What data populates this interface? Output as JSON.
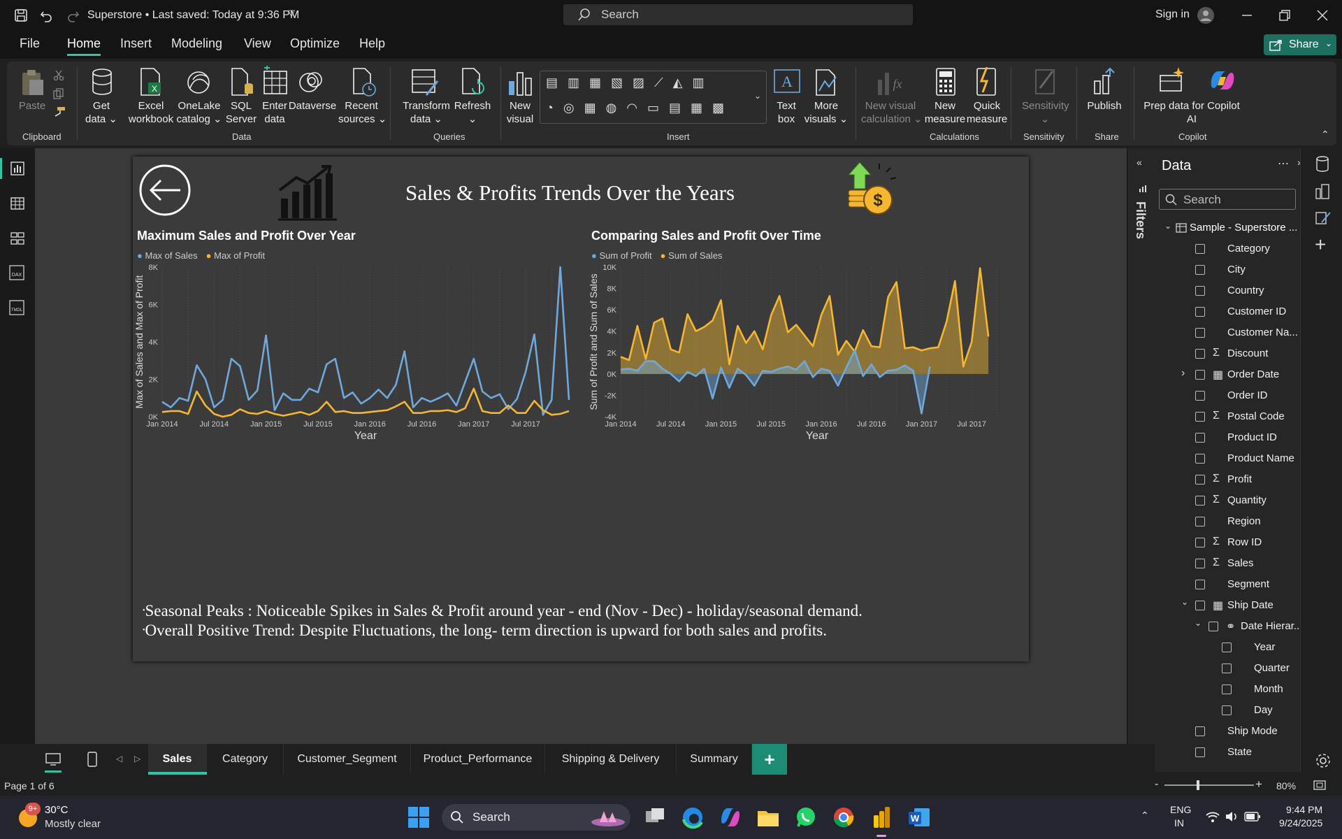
{
  "window": {
    "title": "Superstore • Last saved: Today at 9:36 PM",
    "search_placeholder": "Search",
    "sign_in": "Sign in"
  },
  "menu": {
    "items": [
      "File",
      "Home",
      "Insert",
      "Modeling",
      "View",
      "Optimize",
      "Help"
    ],
    "active": "Home",
    "share": "Share"
  },
  "ribbon": {
    "clipboard": {
      "paste": "Paste",
      "group": "Clipboard"
    },
    "data": {
      "get_data": [
        "Get",
        "data ⌄"
      ],
      "excel": [
        "Excel",
        "workbook"
      ],
      "onelake": [
        "OneLake",
        "catalog ⌄"
      ],
      "sql": [
        "SQL",
        "Server"
      ],
      "enter": [
        "Enter",
        "data"
      ],
      "dataverse": "Dataverse",
      "recent": [
        "Recent",
        "sources ⌄"
      ],
      "group": "Data"
    },
    "queries": {
      "transform": [
        "Transform",
        "data ⌄"
      ],
      "refresh": [
        "Refresh",
        "⌄"
      ],
      "group": "Queries"
    },
    "insert": {
      "new_visual": [
        "New",
        "visual"
      ],
      "text_box": [
        "Text",
        "box"
      ],
      "more_visuals": [
        "More",
        "visuals ⌄"
      ],
      "group": "Insert"
    },
    "calculations": {
      "new_visual_calc": [
        "New visual",
        "calculation ⌄"
      ],
      "new_measure": [
        "New",
        "measure"
      ],
      "quick_measure": [
        "Quick",
        "measure"
      ],
      "group": "Calculations"
    },
    "sensitivity": {
      "label": [
        "Sensitivity",
        "⌄"
      ],
      "group": "Sensitivity"
    },
    "share": {
      "publish": "Publish",
      "group": "Share"
    },
    "copilot": {
      "prep": [
        "Prep data for Copilot",
        "AI"
      ],
      "group": "Copilot"
    }
  },
  "report": {
    "title": "Sales & Profits Trends Over the Years",
    "bullets": [
      "Seasonal Peaks : Noticeable Spikes in Sales & Profit around year - end (Nov - Dec) - holiday/seasonal demand.",
      "Overall Positive Trend: Despite Fluctuations, the long- term direction is upward for both sales and profits."
    ]
  },
  "chart_data": [
    {
      "type": "line",
      "title": "Maximum Sales and Profit Over Year",
      "xlabel": "Year",
      "ylabel": "Max of Sales and Max of Profit",
      "ylim": [
        0,
        8000
      ],
      "yticks": [
        "0K",
        "2K",
        "4K",
        "6K",
        "8K"
      ],
      "xticks": [
        "Jan 2014",
        "Jul 2014",
        "Jan 2015",
        "Jul 2015",
        "Jan 2016",
        "Jul 2016",
        "Jan 2017",
        "Jul 2017"
      ],
      "x_start": "2014-01",
      "legend": "top-left",
      "series": [
        {
          "name": "Max of Sales",
          "color": "#6fa8dc",
          "values": [
            800,
            500,
            1000,
            850,
            2750,
            2000,
            500,
            900,
            3100,
            2700,
            900,
            1400,
            4350,
            350,
            1250,
            900,
            900,
            1500,
            1300,
            2800,
            3100,
            1000,
            1300,
            700,
            1000,
            1450,
            1000,
            1700,
            3500,
            500,
            1000,
            800,
            1000,
            1250,
            600,
            1850,
            3100,
            1350,
            1000,
            1200,
            400,
            950,
            2400,
            4400,
            100,
            900,
            8000,
            900
          ]
        },
        {
          "name": "Max of Profit",
          "color": "#f5b731",
          "values": [
            250,
            300,
            300,
            150,
            1350,
            600,
            150,
            0,
            100,
            400,
            200,
            150,
            300,
            150,
            50,
            150,
            250,
            100,
            300,
            800,
            250,
            300,
            200,
            200,
            250,
            300,
            350,
            550,
            800,
            200,
            200,
            300,
            300,
            350,
            250,
            450,
            1500,
            300,
            200,
            200,
            600,
            200,
            200,
            850,
            350,
            100,
            150,
            300
          ]
        }
      ]
    },
    {
      "type": "area",
      "title": "Comparing Sales and Profit Over Time",
      "xlabel": "Year",
      "ylabel": "Sum of Profit and Sum of Sales",
      "ylim": [
        -4000,
        10000
      ],
      "yticks": [
        "-4K",
        "-2K",
        "0K",
        "2K",
        "4K",
        "6K",
        "8K",
        "10K"
      ],
      "xticks": [
        "Jan 2014",
        "Jul 2014",
        "Jan 2015",
        "Jul 2015",
        "Jan 2016",
        "Jul 2016",
        "Jan 2017",
        "Jul 2017"
      ],
      "x_start": "2014-01",
      "legend": "top-left",
      "series": [
        {
          "name": "Sum of Profit",
          "color": "#6fa8dc",
          "values": [
            400,
            500,
            300,
            1200,
            1200,
            500,
            0,
            -700,
            200,
            -200,
            500,
            -2300,
            600,
            -1300,
            500,
            -100,
            -1100,
            300,
            200,
            500,
            700,
            400,
            1200,
            -300,
            500,
            300,
            -1100,
            600,
            2200,
            -200,
            900,
            -300,
            300,
            400,
            800,
            300,
            -3700,
            700
          ]
        },
        {
          "name": "Sum of Sales",
          "color": "#f5b731",
          "values": [
            1600,
            1300,
            4500,
            1400,
            4800,
            5200,
            2300,
            2000,
            5600,
            4000,
            4400,
            5000,
            6900,
            900,
            4500,
            2900,
            4000,
            2300,
            5500,
            7300,
            3900,
            4600,
            3600,
            2600,
            5500,
            7300,
            1800,
            3100,
            2100,
            4100,
            2600,
            2500,
            7200,
            8600,
            2400,
            2500,
            2200,
            2400,
            2500,
            4900,
            8700,
            700,
            3000,
            9900,
            3500
          ]
        }
      ]
    }
  ],
  "filters": {
    "label": "Filters"
  },
  "datapane": {
    "title": "Data",
    "search_placeholder": "Search",
    "table": "Sample - Superstore ...",
    "fields": [
      {
        "name": "Category",
        "sigma": false
      },
      {
        "name": "City",
        "sigma": false
      },
      {
        "name": "Country",
        "sigma": false
      },
      {
        "name": "Customer ID",
        "sigma": false
      },
      {
        "name": "Customer Na...",
        "sigma": false
      },
      {
        "name": "Discount",
        "sigma": true
      },
      {
        "name": "Order Date",
        "sigma": false,
        "date": true,
        "expand": "›"
      },
      {
        "name": "Order ID",
        "sigma": false
      },
      {
        "name": "Postal Code",
        "sigma": true
      },
      {
        "name": "Product ID",
        "sigma": false
      },
      {
        "name": "Product Name",
        "sigma": false
      },
      {
        "name": "Profit",
        "sigma": true
      },
      {
        "name": "Quantity",
        "sigma": true
      },
      {
        "name": "Region",
        "sigma": false
      },
      {
        "name": "Row ID",
        "sigma": true
      },
      {
        "name": "Sales",
        "sigma": true
      },
      {
        "name": "Segment",
        "sigma": false
      },
      {
        "name": "Ship Date",
        "sigma": false,
        "date": true,
        "expand": "⌄"
      }
    ],
    "hierarchy": {
      "name": "Date Hierar...",
      "levels": [
        "Year",
        "Quarter",
        "Month",
        "Day"
      ]
    },
    "after": [
      {
        "name": "Ship Mode"
      },
      {
        "name": "State"
      }
    ]
  },
  "pages": {
    "tabs": [
      "Sales",
      "Category",
      "Customer_Segment",
      "Product_Performance",
      "Shipping & Delivery",
      "Summary"
    ],
    "active": "Sales",
    "add": "+"
  },
  "status": {
    "page": "Page 1 of 6",
    "zoom": "80%"
  },
  "taskbar": {
    "weather_temp": "30°C",
    "weather_desc": "Mostly clear",
    "badge": "9+",
    "search": "Search",
    "lang": [
      "ENG",
      "IN"
    ],
    "time": "9:44 PM",
    "date": "9/24/2025"
  }
}
